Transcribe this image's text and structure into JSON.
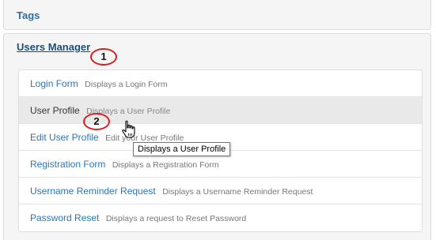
{
  "panels": {
    "tags": {
      "title": "Tags"
    },
    "users_manager": {
      "title": "Users Manager",
      "items": [
        {
          "title": "Login Form",
          "description": "Displays a Login Form"
        },
        {
          "title": "User Profile",
          "description": "Displays a User Profile"
        },
        {
          "title": "Edit User Profile",
          "description": "Edit your User Profile"
        },
        {
          "title": "Registration Form",
          "description": "Displays a Registration Form"
        },
        {
          "title": "Username Reminder Request",
          "description": "Displays a Username Reminder Request"
        },
        {
          "title": "Password Reset",
          "description": "Displays a request to Reset Password"
        }
      ]
    }
  },
  "annotations": {
    "marker_1": "1",
    "marker_2": "2"
  },
  "tooltip": {
    "text": "Displays a User Profile"
  },
  "cursor": {
    "icon": "hand-pointer-icon"
  },
  "colors": {
    "link": "#2a76b8",
    "annotation_circle": "#d62020",
    "hover_row": "#e9e9e9"
  }
}
